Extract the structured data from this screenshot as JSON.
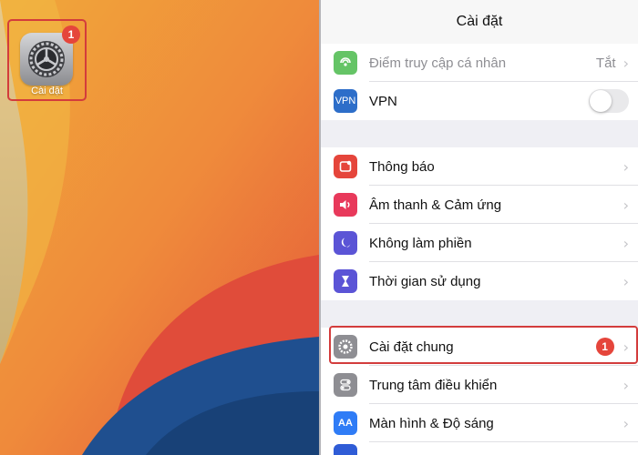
{
  "home": {
    "app_label": "Cài đặt",
    "app_badge": "1",
    "app_icon": "gear-icon"
  },
  "settings": {
    "title": "Cài đặt",
    "group1": [
      {
        "label": "Điểm truy cập cá nhân",
        "value": "Tắt",
        "icon": "hotspot-icon",
        "color": "#65c466",
        "muted": true
      },
      {
        "label": "VPN",
        "icon": "vpn-icon",
        "color": "#2d6ec9",
        "toggle": "off"
      }
    ],
    "group2": [
      {
        "label": "Thông báo",
        "icon": "notifications-icon",
        "color": "#e5453b"
      },
      {
        "label": "Âm thanh & Cảm ứng",
        "icon": "sound-icon",
        "color": "#e8395b"
      },
      {
        "label": "Không làm phiền",
        "icon": "moon-icon",
        "color": "#5b54d6"
      },
      {
        "label": "Thời gian sử dụng",
        "icon": "hourglass-icon",
        "color": "#5b54d6"
      }
    ],
    "group3": [
      {
        "label": "Cài đặt chung",
        "icon": "gear-icon",
        "color": "#8e8e93",
        "badge": "1"
      },
      {
        "label": "Trung tâm điều khiển",
        "icon": "control-center-icon",
        "color": "#8e8e93"
      },
      {
        "label": "Màn hình & Độ sáng",
        "icon": "display-icon",
        "color": "#2f7cf6",
        "icon_text": "AA"
      }
    ]
  }
}
